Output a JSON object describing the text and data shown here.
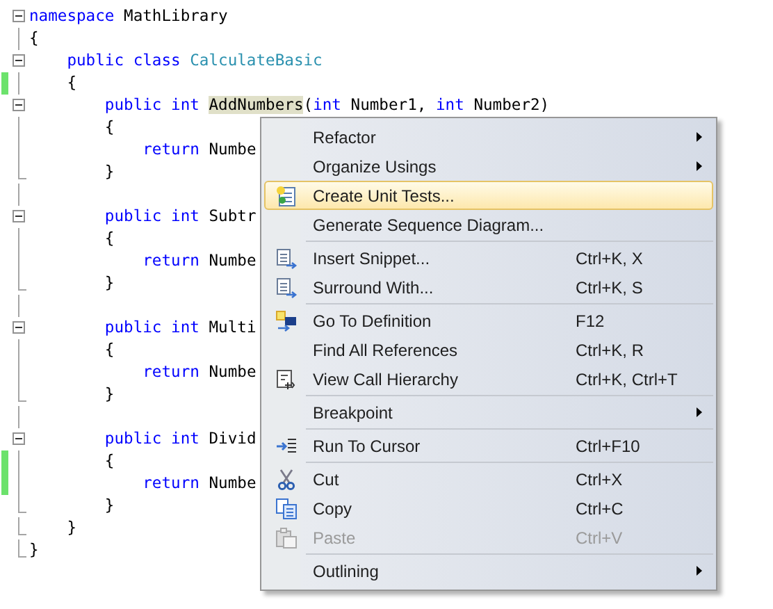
{
  "editor": {
    "lines": [
      {
        "kind": "fold-start",
        "changed": false,
        "tokens": [
          {
            "text": "namespace ",
            "kind": "keyword"
          },
          {
            "text": "MathLibrary",
            "kind": "plain"
          }
        ]
      },
      {
        "kind": "plain",
        "changed": false,
        "tokens": [
          {
            "text": "{",
            "kind": "plain"
          }
        ]
      },
      {
        "kind": "fold-start",
        "changed": false,
        "tokens": [
          {
            "text": "    public class ",
            "kind": "keyword"
          },
          {
            "text": "CalculateBasic",
            "kind": "type"
          }
        ]
      },
      {
        "kind": "plain",
        "changed": true,
        "tokens": [
          {
            "text": "    {",
            "kind": "plain"
          }
        ]
      },
      {
        "kind": "fold-start",
        "changed": false,
        "tokens": [
          {
            "text": "        public int ",
            "kind": "keyword"
          },
          {
            "text": "AddNumbers",
            "kind": "highlight"
          },
          {
            "text": "(",
            "kind": "plain"
          },
          {
            "text": "int",
            "kind": "keyword"
          },
          {
            "text": " Number1, ",
            "kind": "plain"
          },
          {
            "text": "int",
            "kind": "keyword"
          },
          {
            "text": " Number2)",
            "kind": "plain"
          }
        ]
      },
      {
        "kind": "plain",
        "changed": false,
        "tokens": [
          {
            "text": "        {",
            "kind": "plain"
          }
        ]
      },
      {
        "kind": "plain",
        "changed": false,
        "tokens": [
          {
            "text": "            return ",
            "kind": "keyword"
          },
          {
            "text": "Numbe",
            "kind": "plain"
          }
        ]
      },
      {
        "kind": "fold-end",
        "changed": false,
        "tokens": [
          {
            "text": "        }",
            "kind": "plain"
          }
        ]
      },
      {
        "kind": "plain",
        "changed": false
      },
      {
        "kind": "fold-start",
        "changed": false,
        "tokens": [
          {
            "text": "        public int ",
            "kind": "keyword"
          },
          {
            "text": "Subtr",
            "kind": "plain"
          }
        ]
      },
      {
        "kind": "plain",
        "changed": false,
        "tokens": [
          {
            "text": "        {",
            "kind": "plain"
          }
        ]
      },
      {
        "kind": "plain",
        "changed": false,
        "tokens": [
          {
            "text": "            return ",
            "kind": "keyword"
          },
          {
            "text": "Numbe",
            "kind": "plain"
          }
        ]
      },
      {
        "kind": "fold-end",
        "changed": false,
        "tokens": [
          {
            "text": "        }",
            "kind": "plain"
          }
        ]
      },
      {
        "kind": "plain",
        "changed": false
      },
      {
        "kind": "fold-start",
        "changed": false,
        "tokens": [
          {
            "text": "        public int ",
            "kind": "keyword"
          },
          {
            "text": "Multi",
            "kind": "plain"
          }
        ]
      },
      {
        "kind": "plain",
        "changed": false,
        "tokens": [
          {
            "text": "        {",
            "kind": "plain"
          }
        ]
      },
      {
        "kind": "plain",
        "changed": false,
        "tokens": [
          {
            "text": "            return ",
            "kind": "keyword"
          },
          {
            "text": "Numbe",
            "kind": "plain"
          }
        ]
      },
      {
        "kind": "fold-end",
        "changed": false,
        "tokens": [
          {
            "text": "        }",
            "kind": "plain"
          }
        ]
      },
      {
        "kind": "plain",
        "changed": false
      },
      {
        "kind": "fold-start",
        "changed": false,
        "tokens": [
          {
            "text": "        public int ",
            "kind": "keyword"
          },
          {
            "text": "Divid",
            "kind": "plain"
          }
        ]
      },
      {
        "kind": "plain",
        "changed": true,
        "tokens": [
          {
            "text": "        {",
            "kind": "plain"
          }
        ]
      },
      {
        "kind": "plain",
        "changed": true,
        "tokens": [
          {
            "text": "            return ",
            "kind": "keyword"
          },
          {
            "text": "Numbe",
            "kind": "plain"
          }
        ]
      },
      {
        "kind": "fold-end",
        "changed": false,
        "tokens": [
          {
            "text": "        }",
            "kind": "plain"
          }
        ]
      },
      {
        "kind": "fold-end",
        "changed": false,
        "tokens": [
          {
            "text": "    }",
            "kind": "plain"
          }
        ]
      },
      {
        "kind": "fold-end",
        "changed": false,
        "tokens": [
          {
            "text": "}",
            "kind": "plain"
          }
        ]
      }
    ]
  },
  "context_menu": {
    "items": [
      {
        "kind": "item",
        "label": "Refactor",
        "submenu": true,
        "selected": false,
        "disabled": false
      },
      {
        "kind": "item",
        "label": "Organize Usings",
        "submenu": true,
        "selected": false,
        "disabled": false
      },
      {
        "kind": "item",
        "label": "Create Unit Tests...",
        "submenu": false,
        "selected": true,
        "disabled": false
      },
      {
        "kind": "item",
        "label": "Generate Sequence Diagram...",
        "submenu": false,
        "selected": false,
        "disabled": false
      },
      {
        "kind": "separator"
      },
      {
        "kind": "item",
        "label": "Insert Snippet...",
        "shortcut": "Ctrl+K, X",
        "submenu": false,
        "selected": false,
        "disabled": false
      },
      {
        "kind": "item",
        "label": "Surround With...",
        "shortcut": "Ctrl+K, S",
        "submenu": false,
        "selected": false,
        "disabled": false
      },
      {
        "kind": "separator"
      },
      {
        "kind": "item",
        "label": "Go To Definition",
        "shortcut": "F12",
        "submenu": false,
        "selected": false,
        "disabled": false
      },
      {
        "kind": "item",
        "label": "Find All References",
        "shortcut": "Ctrl+K, R",
        "submenu": false,
        "selected": false,
        "disabled": false
      },
      {
        "kind": "item",
        "label": "View Call Hierarchy",
        "shortcut": "Ctrl+K, Ctrl+T",
        "submenu": false,
        "selected": false,
        "disabled": false
      },
      {
        "kind": "separator"
      },
      {
        "kind": "item",
        "label": "Breakpoint",
        "submenu": true,
        "selected": false,
        "disabled": false
      },
      {
        "kind": "separator"
      },
      {
        "kind": "item",
        "label": "Run To Cursor",
        "shortcut": "Ctrl+F10",
        "submenu": false,
        "selected": false,
        "disabled": false
      },
      {
        "kind": "separator"
      },
      {
        "kind": "item",
        "label": "Cut",
        "shortcut": "Ctrl+X",
        "submenu": false,
        "selected": false,
        "disabled": false
      },
      {
        "kind": "item",
        "label": "Copy",
        "shortcut": "Ctrl+C",
        "submenu": false,
        "selected": false,
        "disabled": false
      },
      {
        "kind": "item",
        "label": "Paste",
        "shortcut": "Ctrl+V",
        "submenu": false,
        "selected": false,
        "disabled": true
      },
      {
        "kind": "separator"
      },
      {
        "kind": "item",
        "label": "Outlining",
        "submenu": true,
        "selected": false,
        "disabled": false
      }
    ]
  }
}
